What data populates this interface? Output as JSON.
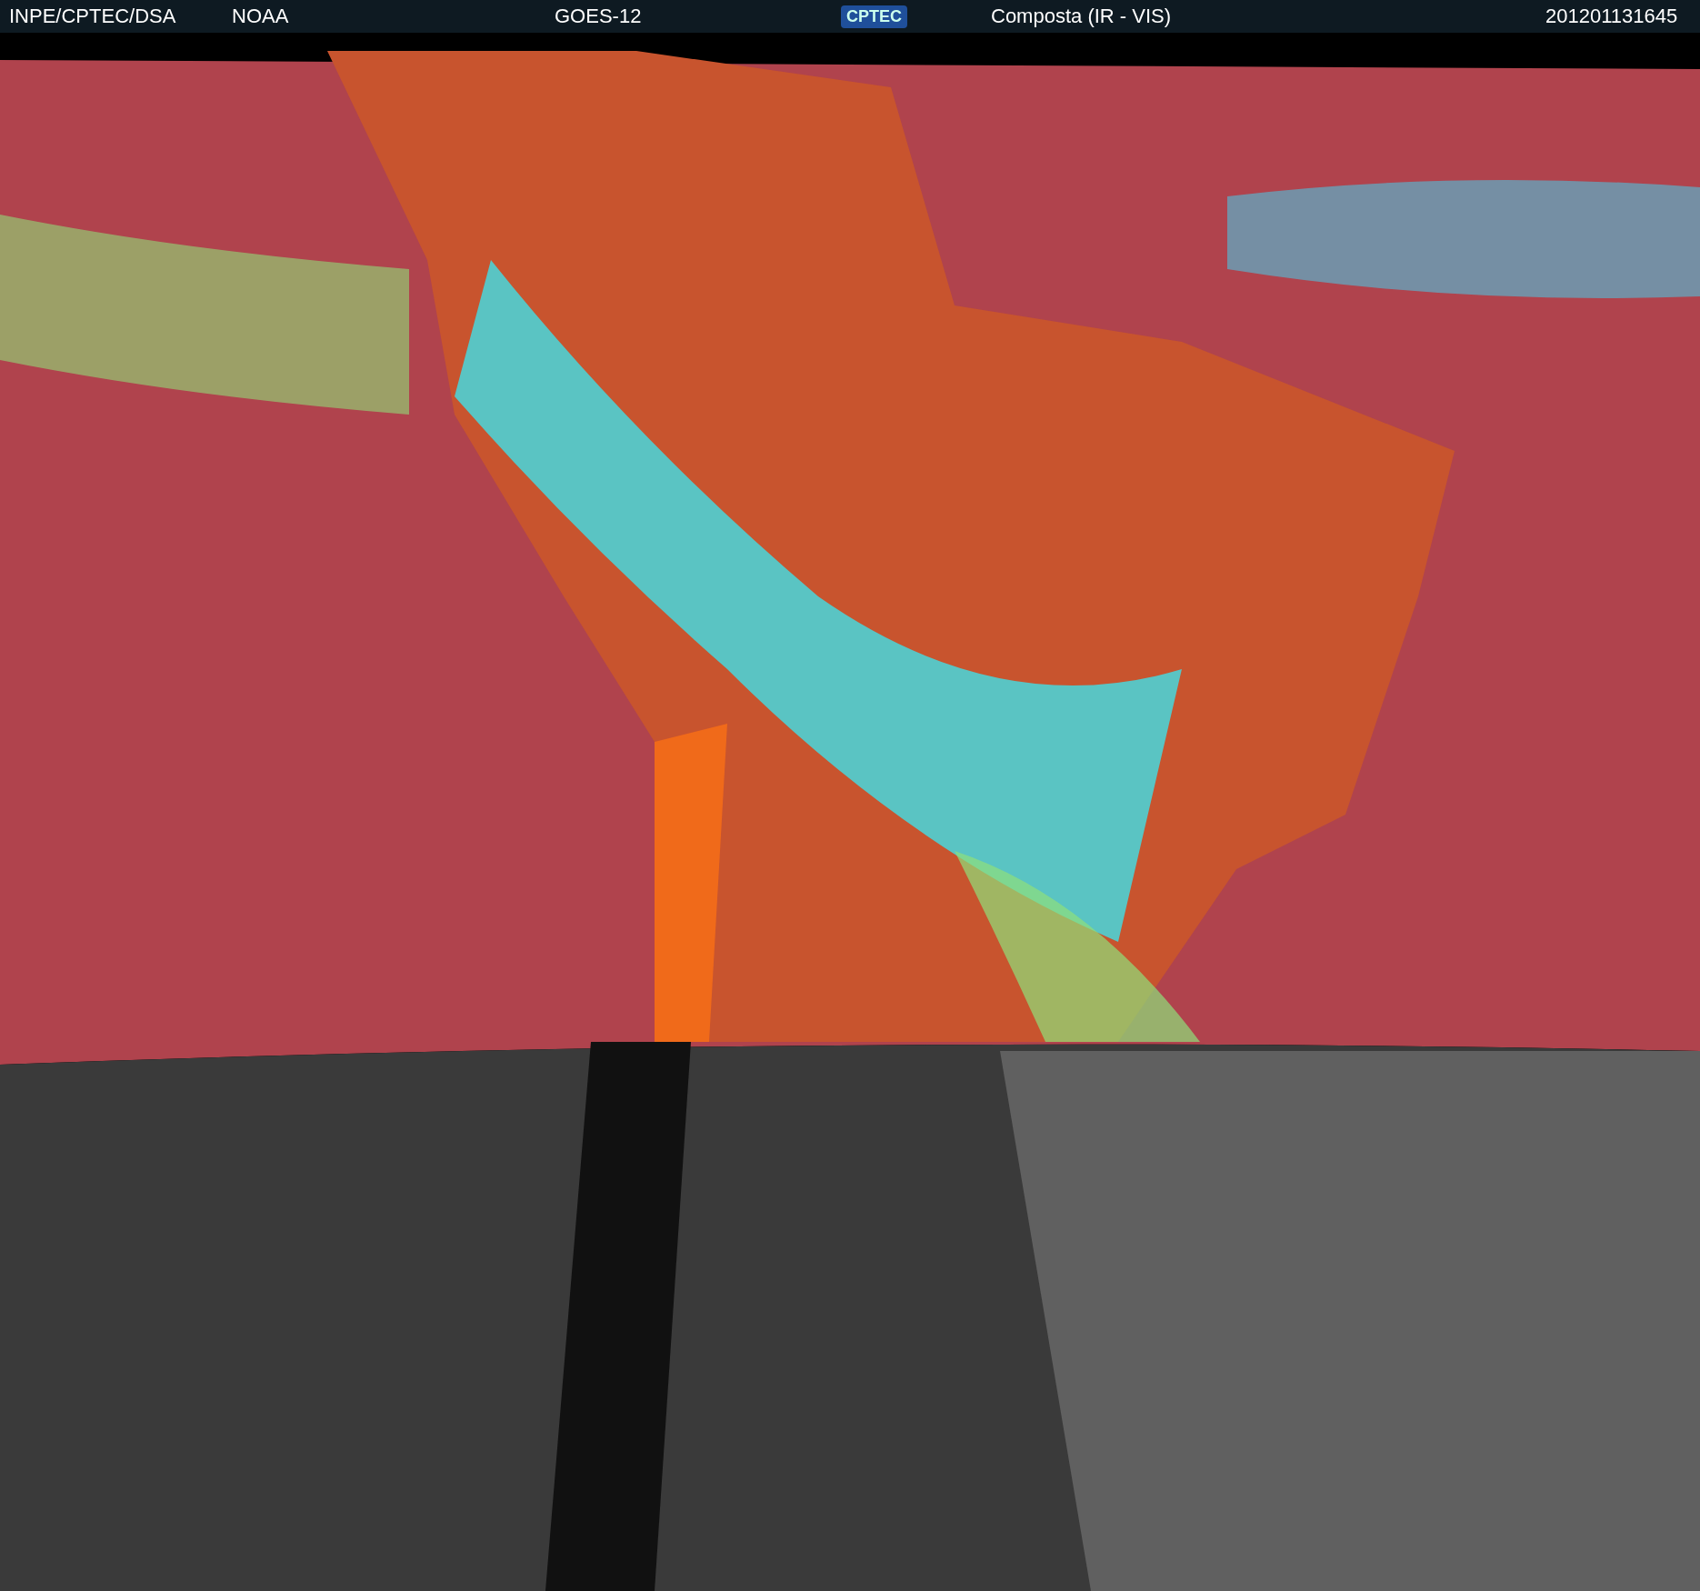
{
  "header": {
    "source": "INPE/CPTEC/DSA",
    "agency": "NOAA",
    "satellite": "GOES-12",
    "logo": "CPTEC",
    "product": "Composta (IR - VIS)",
    "timestamp": "201201131645"
  }
}
